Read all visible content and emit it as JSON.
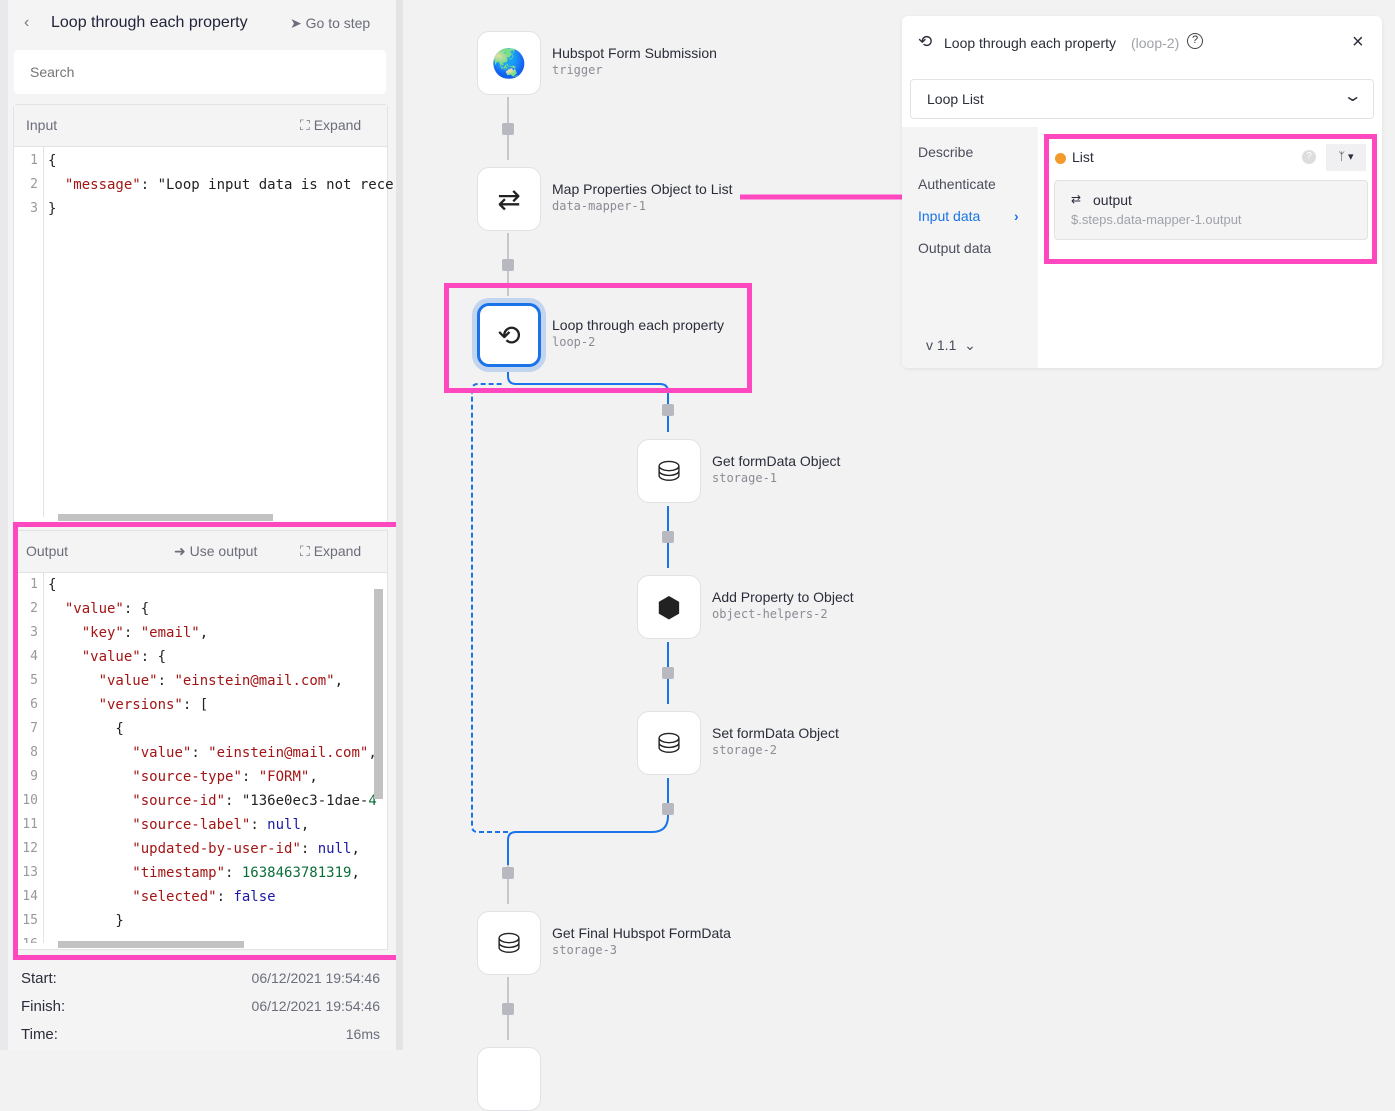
{
  "left_panel": {
    "back_icon": "chevron-left-icon",
    "title": "Loop through each property",
    "go_to_step": "Go to step",
    "search_placeholder": "Search",
    "input": {
      "label": "Input",
      "expand": "Expand",
      "lines": [
        {
          "n": "1",
          "t": "{"
        },
        {
          "n": "2",
          "t": "  \"message\": \"Loop input data is not rece"
        },
        {
          "n": "3",
          "t": "}"
        }
      ]
    },
    "output": {
      "label": "Output",
      "use_output": "Use output",
      "expand": "Expand",
      "lines": [
        {
          "n": "1",
          "t": "{"
        },
        {
          "n": "2",
          "t": "  \"value\": {"
        },
        {
          "n": "3",
          "t": "    \"key\": \"email\","
        },
        {
          "n": "4",
          "t": "    \"value\": {"
        },
        {
          "n": "5",
          "t": "      \"value\": \"einstein@mail.com\","
        },
        {
          "n": "6",
          "t": "      \"versions\": ["
        },
        {
          "n": "7",
          "t": "        {"
        },
        {
          "n": "8",
          "t": "          \"value\": \"einstein@mail.com\","
        },
        {
          "n": "9",
          "t": "          \"source-type\": \"FORM\","
        },
        {
          "n": "10",
          "t": "          \"source-id\": \"136e0ec3-1dae-4"
        },
        {
          "n": "11",
          "t": "          \"source-label\": null,"
        },
        {
          "n": "12",
          "t": "          \"updated-by-user-id\": null,"
        },
        {
          "n": "13",
          "t": "          \"timestamp\": 1638463781319,"
        },
        {
          "n": "14",
          "t": "          \"selected\": false"
        },
        {
          "n": "15",
          "t": "        }"
        },
        {
          "n": "16",
          "t": ""
        }
      ]
    },
    "stats": {
      "start_label": "Start:",
      "start": "06/12/2021 19:54:46",
      "finish_label": "Finish:",
      "finish": "06/12/2021 19:54:46",
      "time_label": "Time:",
      "time": "16ms"
    }
  },
  "flow": {
    "nodes": [
      {
        "label": "Hubspot Form Submission",
        "id": "trigger",
        "icon": "globe-icon"
      },
      {
        "label": "Map Properties Object to List",
        "id": "data-mapper-1",
        "icon": "shuffle-icon"
      },
      {
        "label": "Loop through each property",
        "id": "loop-2",
        "icon": "loop-icon"
      },
      {
        "label": "Get formData Object",
        "id": "storage-1",
        "icon": "database-edit-icon"
      },
      {
        "label": "Add Property to Object",
        "id": "object-helpers-2",
        "icon": "cube-icon"
      },
      {
        "label": "Set formData Object",
        "id": "storage-2",
        "icon": "database-edit-icon"
      },
      {
        "label": "Get Final Hubspot FormData",
        "id": "storage-3",
        "icon": "database-edit-icon"
      }
    ]
  },
  "config_panel": {
    "title": "Loop through each property",
    "step_id": "(loop-2)",
    "operation": "Loop List",
    "menu": [
      "Describe",
      "Authenticate",
      "Input data",
      "Output data"
    ],
    "active_menu": "Input data",
    "version": "v 1.1",
    "field": {
      "label": "List",
      "required_color": "#f39a2b",
      "value_label": "output",
      "value_path": "$.steps.data-mapper-1.output"
    }
  },
  "colors": {
    "highlight": "#ff48c0",
    "accent": "#1a73e8"
  }
}
